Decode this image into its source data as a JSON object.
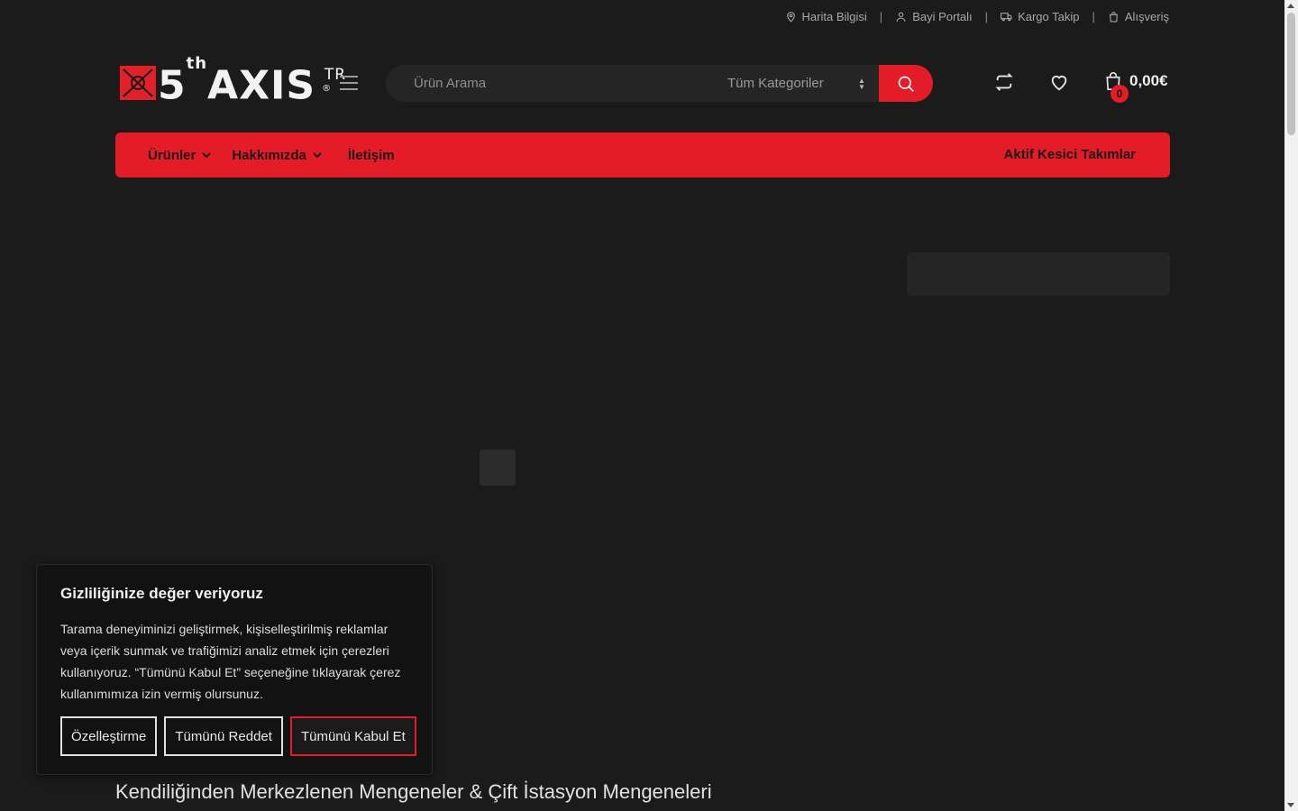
{
  "topbar": {
    "links": [
      {
        "label": "Harita Bilgisi",
        "icon": "map-pin-icon"
      },
      {
        "label": "Bayi Portalı",
        "icon": "user-icon"
      },
      {
        "label": "Kargo Takip",
        "icon": "truck-icon"
      },
      {
        "label": "Alışveriş",
        "icon": "shopping-bag-icon"
      }
    ]
  },
  "header": {
    "logo_text": "5thAXIS TR",
    "search": {
      "placeholder": "Ürün Arama",
      "category": "Tüm Kategoriler"
    },
    "cart": {
      "total": "0,00€",
      "count": "0"
    }
  },
  "nav": {
    "items": [
      {
        "label": "Ürünler"
      },
      {
        "label": "Hakkımızda"
      },
      {
        "label": "İletişim"
      }
    ],
    "right_label": "Aktif Kesici Takımlar"
  },
  "main": {
    "title": "Kendiliğinden Merkezlenen Mengeneler & Çift İstasyon Mengeneleri"
  },
  "cookie": {
    "title": "Gizliliğinize değer veriyoruz",
    "text": "Tarama deneyiminizi geliştirmek, kişiselleştirilmiş reklamlar veya içerik sunmak ve trafiğimizi analiz etmek için çerezleri kullanıyoruz. “Tümünü Kabul Et” seçeneğine tıklayarak çerez kullanımımıza izin vermiş olursunuz.",
    "customize": "Özelleştirme",
    "reject": "Tümünü Reddet",
    "accept": "Tümünü Kabul Et"
  },
  "colors": {
    "accent": "#e41c27",
    "background": "#1b1b1c"
  }
}
